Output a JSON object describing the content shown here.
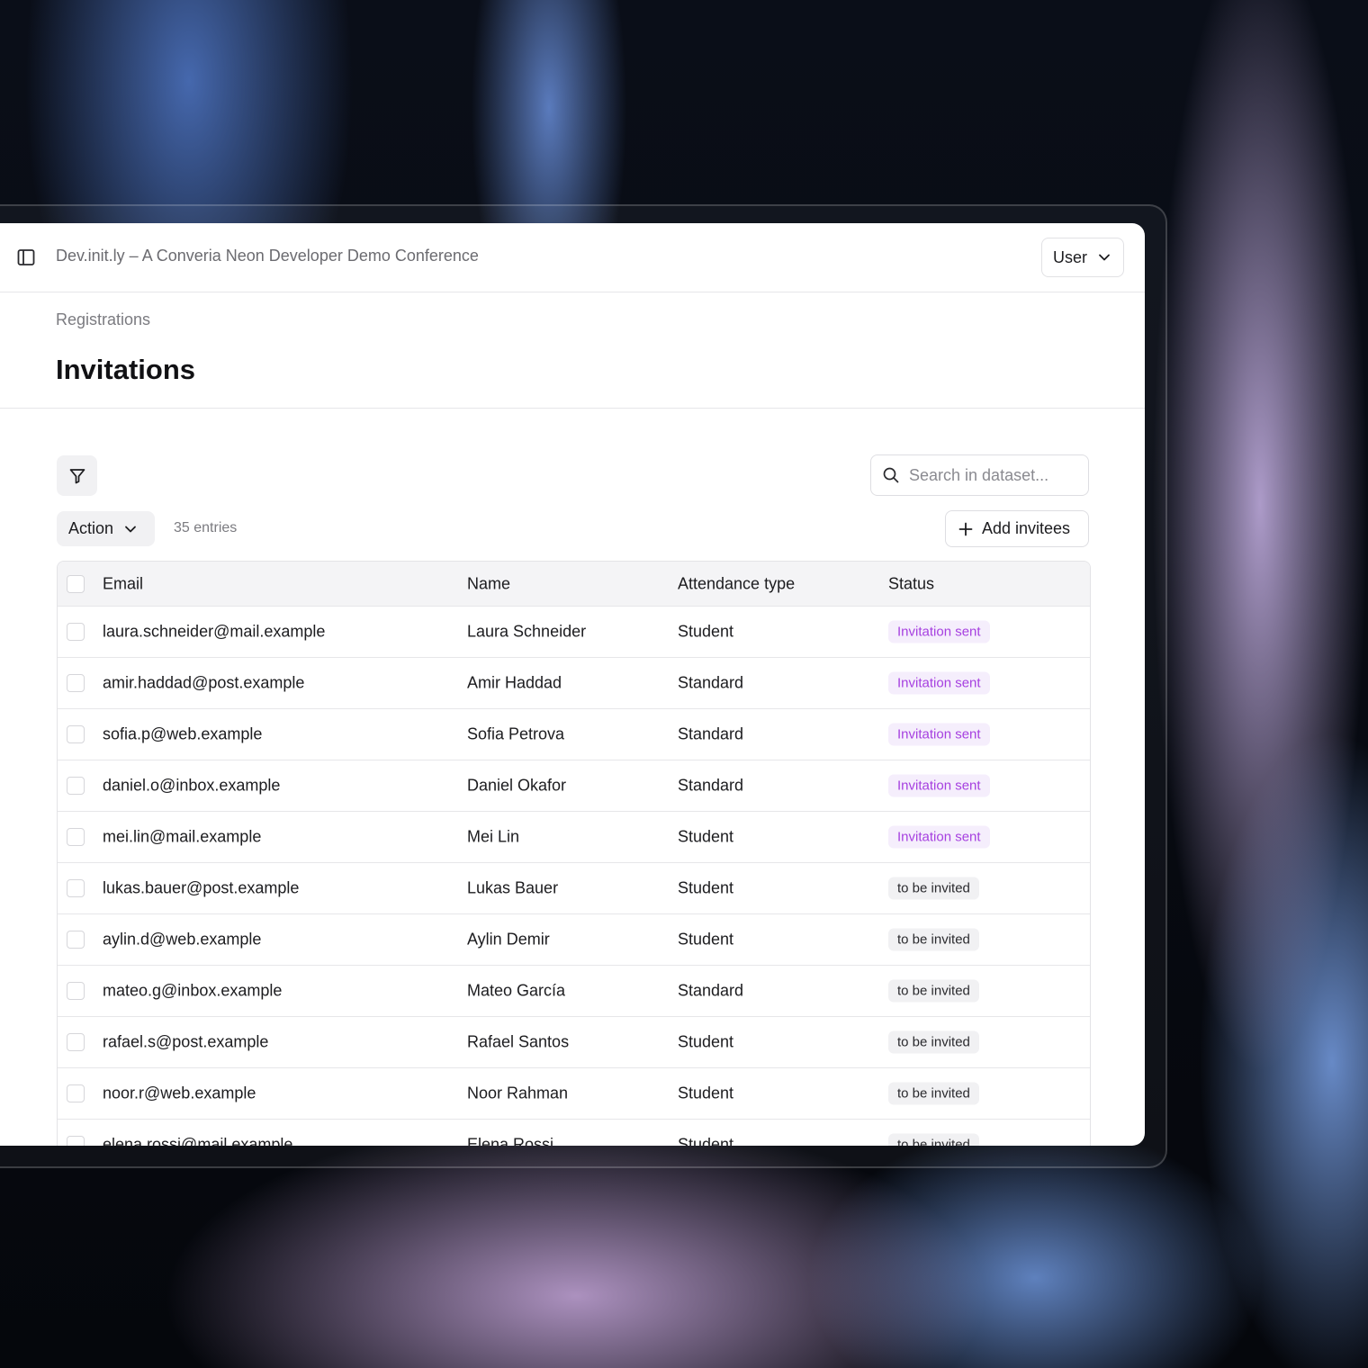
{
  "app": {
    "title": "Dev.init.ly – A Converia Neon Developer Demo Conference",
    "user_label": "User"
  },
  "header": {
    "breadcrumb": "Registrations",
    "title": "Invitations"
  },
  "toolbar": {
    "search_placeholder": "Search in dataset...",
    "action_label": "Action",
    "entries_label": "35 entries",
    "add_label": "Add invitees"
  },
  "table": {
    "columns": [
      "Email",
      "Name",
      "Attendance type",
      "Status"
    ],
    "rows": [
      {
        "email": "laura.schneider@mail.example",
        "name": "Laura Schneider",
        "type": "Student",
        "status": "Invitation sent"
      },
      {
        "email": "amir.haddad@post.example",
        "name": "Amir Haddad",
        "type": "Standard",
        "status": "Invitation sent"
      },
      {
        "email": "sofia.p@web.example",
        "name": "Sofia Petrova",
        "type": "Standard",
        "status": "Invitation sent"
      },
      {
        "email": "daniel.o@inbox.example",
        "name": "Daniel Okafor",
        "type": "Standard",
        "status": "Invitation sent"
      },
      {
        "email": "mei.lin@mail.example",
        "name": "Mei Lin",
        "type": "Student",
        "status": "Invitation sent"
      },
      {
        "email": "lukas.bauer@post.example",
        "name": "Lukas Bauer",
        "type": "Student",
        "status": "to be invited"
      },
      {
        "email": "aylin.d@web.example",
        "name": "Aylin Demir",
        "type": "Student",
        "status": "to be invited"
      },
      {
        "email": "mateo.g@inbox.example",
        "name": "Mateo García",
        "type": "Standard",
        "status": "to be invited"
      },
      {
        "email": "rafael.s@post.example",
        "name": "Rafael Santos",
        "type": "Student",
        "status": "to be invited"
      },
      {
        "email": "noor.r@web.example",
        "name": "Noor Rahman",
        "type": "Student",
        "status": "to be invited"
      },
      {
        "email": "elena.rossi@mail.example",
        "name": "Elena Rossi",
        "type": "Student",
        "status": "to be invited"
      }
    ]
  },
  "colors": {
    "sent_text": "#a640e0",
    "sent_bg": "#f5eefc",
    "pending_bg": "#f1f1f3"
  },
  "icons": [
    "sidebar-toggle-icon",
    "chevron-down-icon",
    "filter-icon",
    "search-icon",
    "plus-icon"
  ]
}
